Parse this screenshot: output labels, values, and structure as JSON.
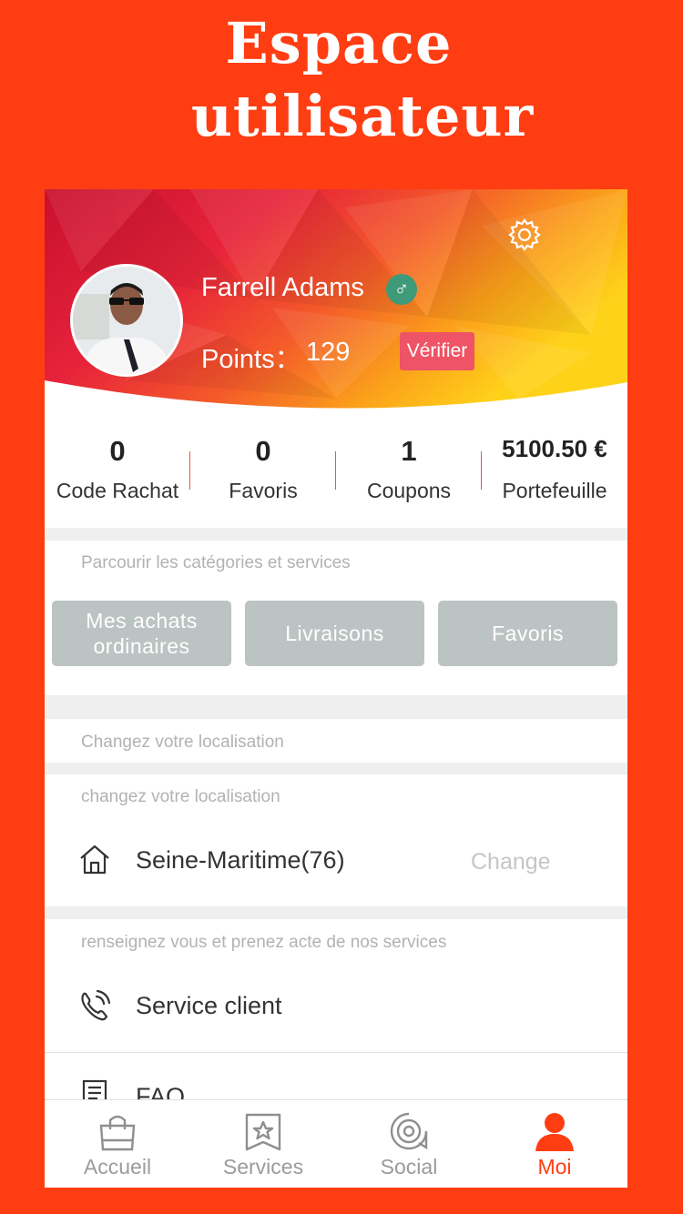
{
  "promo": {
    "line1": "Espace",
    "line2": "utilisateur"
  },
  "colors": {
    "brand": "#ff3d12",
    "accent_active": "#ff3d12",
    "button_gray": "#bcc3c3",
    "verify_badge": "#ee5466",
    "gender_badge": "#3e9a78"
  },
  "profile": {
    "name": "Farrell Adams",
    "gender_symbol": "♂",
    "points_label": "Points：",
    "points_value": "129",
    "verify_label": "Vérifier"
  },
  "stats": [
    {
      "value": "0",
      "label": "Code Rachat"
    },
    {
      "value": "0",
      "label": "Favoris"
    },
    {
      "value": "1",
      "label": "Coupons"
    },
    {
      "value": "5100.50 €",
      "label": "Portefeuille"
    }
  ],
  "categories": {
    "caption": "Parcourir les catégories  et services",
    "buttons": [
      {
        "label": "Mes achats ordinaires"
      },
      {
        "label": "Livraisons"
      },
      {
        "label": "Favoris"
      }
    ]
  },
  "location": {
    "section_caption": "Changez votre localisation",
    "caption": "changez votre localisation",
    "value": "Seine-Maritime(76)",
    "change_label": "Change"
  },
  "services": {
    "caption": "renseignez vous et prenez acte de nos services",
    "items": [
      {
        "label": "Service client",
        "icon": "phone-icon"
      },
      {
        "label": "FAQ",
        "icon": "document-icon"
      }
    ]
  },
  "tabbar": {
    "tabs": [
      {
        "label": "Accueil",
        "icon": "bag-icon"
      },
      {
        "label": "Services",
        "icon": "star-bookmark-icon"
      },
      {
        "label": "Social",
        "icon": "target-icon"
      },
      {
        "label": "Moi",
        "icon": "person-icon",
        "active": true
      }
    ]
  }
}
